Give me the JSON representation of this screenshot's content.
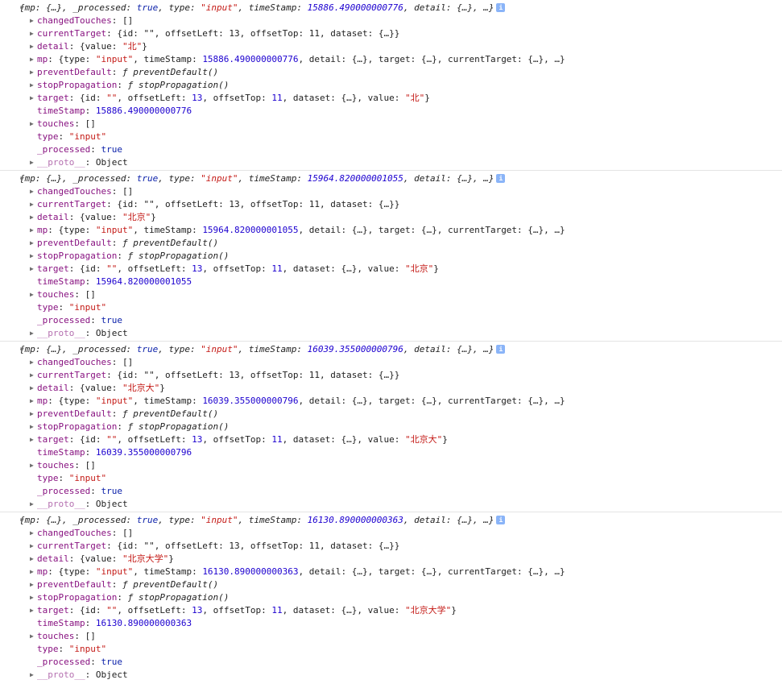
{
  "icons": {
    "expanded": "triangle-down-icon",
    "collapsed": "triangle-right-icon",
    "info": "info-icon"
  },
  "entries": [
    {
      "summary": {
        "timestamp": "15886.490000000776"
      },
      "props": {
        "changedTouches": "[]",
        "currentTarget": "{id: \"\", offsetLeft: 13, offsetTop: 11, dataset: {…}}",
        "detail_value": "\"北\"",
        "mp_timestamp": "15886.490000000776",
        "preventDefault": "ƒ preventDefault()",
        "stopPropagation": "ƒ stopPropagation()",
        "target_value": "\"北\"",
        "timeStamp": "15886.490000000776",
        "touches": "[]",
        "type": "\"input\"",
        "processed": "true",
        "proto": "Object"
      }
    },
    {
      "summary": {
        "timestamp": "15964.820000001055"
      },
      "props": {
        "changedTouches": "[]",
        "currentTarget": "{id: \"\", offsetLeft: 13, offsetTop: 11, dataset: {…}}",
        "detail_value": "\"北京\"",
        "mp_timestamp": "15964.820000001055",
        "preventDefault": "ƒ preventDefault()",
        "stopPropagation": "ƒ stopPropagation()",
        "target_value": "\"北京\"",
        "timeStamp": "15964.820000001055",
        "touches": "[]",
        "type": "\"input\"",
        "processed": "true",
        "proto": "Object"
      }
    },
    {
      "summary": {
        "timestamp": "16039.355000000796"
      },
      "props": {
        "changedTouches": "[]",
        "currentTarget": "{id: \"\", offsetLeft: 13, offsetTop: 11, dataset: {…}}",
        "detail_value": "\"北京大\"",
        "mp_timestamp": "16039.355000000796",
        "preventDefault": "ƒ preventDefault()",
        "stopPropagation": "ƒ stopPropagation()",
        "target_value": "\"北京大\"",
        "timeStamp": "16039.355000000796",
        "touches": "[]",
        "type": "\"input\"",
        "processed": "true",
        "proto": "Object"
      }
    },
    {
      "summary": {
        "timestamp": "16130.890000000363"
      },
      "props": {
        "changedTouches": "[]",
        "currentTarget": "{id: \"\", offsetLeft: 13, offsetTop: 11, dataset: {…}}",
        "detail_value": "\"北京大学\"",
        "mp_timestamp": "16130.890000000363",
        "preventDefault": "ƒ preventDefault()",
        "stopPropagation": "ƒ stopPropagation()",
        "target_value": "\"北京大学\"",
        "timeStamp": "16130.890000000363",
        "touches": "[]",
        "type": "\"input\"",
        "processed": "true",
        "proto": "Object"
      }
    }
  ]
}
